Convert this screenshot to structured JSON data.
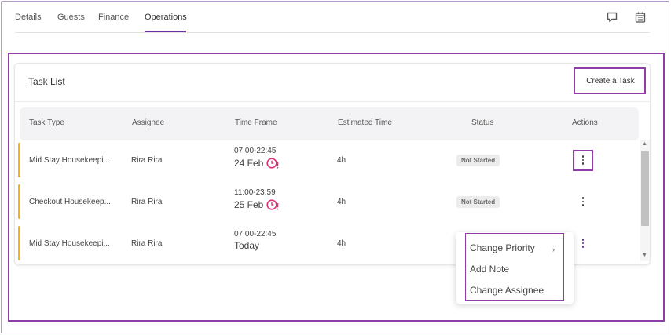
{
  "tabs": [
    "Details",
    "Guests",
    "Finance",
    "Operations"
  ],
  "active_tab": "Operations",
  "task_list": {
    "title": "Task List",
    "create_button": "Create a Task",
    "columns": [
      "Task Type",
      "Assignee",
      "Time Frame",
      "Estimated Time",
      "Status",
      "Actions"
    ],
    "rows": [
      {
        "task_type": "Mid Stay Housekeepi...",
        "assignee": "Rira Rira",
        "time": "07:00-22:45",
        "date": "24 Feb",
        "estimated": "4h",
        "status": "Not Started",
        "overdue_icon": true
      },
      {
        "task_type": "Checkout Housekeep...",
        "assignee": "Rira Rira",
        "time": "11:00-23:59",
        "date": "25 Feb",
        "estimated": "4h",
        "status": "Not Started",
        "overdue_icon": true
      },
      {
        "task_type": "Mid Stay Housekeepi...",
        "assignee": "Rira Rira",
        "time": "07:00-22:45",
        "date": "Today",
        "estimated": "4h",
        "status": "",
        "overdue_icon": false
      }
    ]
  },
  "context_menu": {
    "items": [
      "Change Priority",
      "Add Note",
      "Change Assignee"
    ]
  },
  "icons": {
    "chat": "chat-icon",
    "calendar": "calendar-icon",
    "overdue": "clock-alert-icon"
  },
  "colors": {
    "accent": "#6a2fa0",
    "highlight": "#8e3ea6",
    "row_bar": "#f2b21a",
    "overdue": "#e0307a"
  }
}
